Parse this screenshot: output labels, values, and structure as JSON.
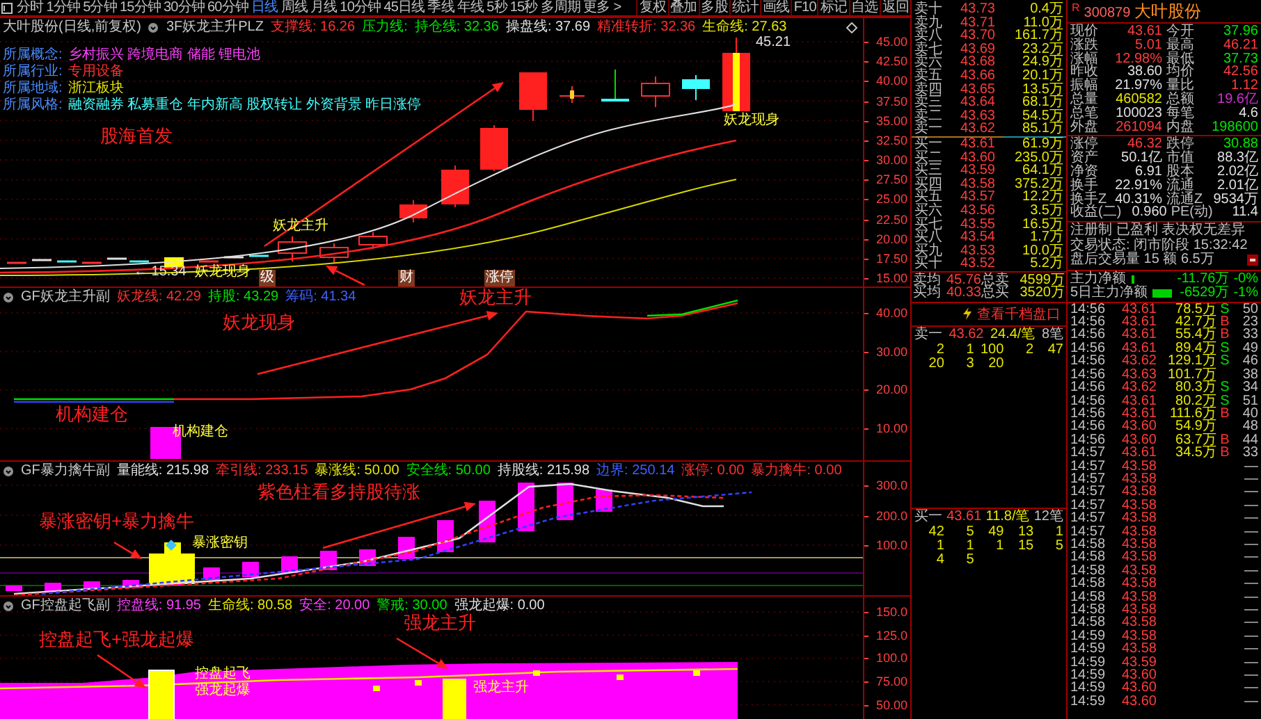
{
  "toolbar": {
    "tabs": [
      {
        "label": "分时",
        "selected": false
      },
      {
        "label": "1分钟",
        "selected": false
      },
      {
        "label": "5分钟",
        "selected": false
      },
      {
        "label": "15分钟",
        "selected": false
      },
      {
        "label": "30分钟",
        "selected": false
      },
      {
        "label": "60分钟",
        "selected": false
      },
      {
        "label": "日线",
        "selected": true
      },
      {
        "label": "周线",
        "selected": false
      },
      {
        "label": "月线",
        "selected": false
      },
      {
        "label": "10分钟",
        "selected": false
      },
      {
        "label": "45日线",
        "selected": false
      },
      {
        "label": "季线",
        "selected": false
      },
      {
        "label": "年线",
        "selected": false
      },
      {
        "label": "5秒",
        "selected": false
      },
      {
        "label": "15秒",
        "selected": false
      },
      {
        "label": "多周期",
        "selected": false
      },
      {
        "label": "更多 >",
        "selected": false
      }
    ],
    "buttons": [
      "复权",
      "叠加",
      "多股",
      "统计",
      "画线",
      "F10",
      "标记",
      "自选",
      "返回"
    ]
  },
  "panels": [
    {
      "kind": "candles",
      "legend": [
        {
          "text": "大叶股份(日线,前复权)",
          "kind": "value",
          "color": "#c8c8c8"
        },
        {
          "text": "3F妖龙主升PLZ",
          "kind": "name",
          "color": "#c8c8c8"
        },
        {
          "text": "支撑线: 16.26",
          "kind": "value",
          "color": "#ff3030"
        },
        {
          "text": "压力线:",
          "kind": "value",
          "color": "#00e000"
        },
        {
          "text": "持仓线: 32.36",
          "kind": "value",
          "color": "#00e000"
        },
        {
          "text": "操盘线: 37.69",
          "kind": "value",
          "color": "#e0e0e0"
        },
        {
          "text": "精准转折: 32.36",
          "kind": "value",
          "color": "#ff3030"
        },
        {
          "text": "生命线: 27.63",
          "kind": "value",
          "color": "#e6e600"
        }
      ],
      "info": [
        {
          "label": "所属概念:",
          "value": "乡村振兴 跨境电商 储能 锂电池",
          "color": "#ff40ff"
        },
        {
          "label": "所属行业:",
          "value": "专用设备",
          "color": "#ff3030"
        },
        {
          "label": "所属地域:",
          "value": "浙江板块",
          "color": "#e6e600"
        },
        {
          "label": "所属风格:",
          "value": "融资融券 私募重仓 年内新高 股权转让 外资背景 昨日涨停",
          "color": "#40ffff"
        }
      ],
      "annotations": [
        {
          "text": "股海首发",
          "kind": "big"
        },
        {
          "text": "45.21",
          "kind": "price"
        },
        {
          "text": "妖龙现身",
          "kind": "tag"
        },
        {
          "text": "← 15.34",
          "kind": "price"
        },
        {
          "text": "妖龙现身",
          "kind": "tag"
        },
        {
          "text": "妖龙主升",
          "kind": "tag"
        },
        {
          "text": "级",
          "kind": "box"
        },
        {
          "text": "财",
          "kind": "box"
        },
        {
          "text": "涨停",
          "kind": "box"
        }
      ],
      "axis": [
        "45.00",
        "42.50",
        "40.00",
        "37.50",
        "35.00",
        "32.50",
        "30.00",
        "27.50",
        "25.00",
        "22.50",
        "20.00",
        "17.50",
        "15.00"
      ]
    },
    {
      "kind": "line",
      "legend": [
        {
          "text": "GF妖龙主升副",
          "kind": "name",
          "color": "#c8c8c8"
        },
        {
          "text": "妖龙线: 42.29",
          "kind": "value",
          "color": "#ff3030"
        },
        {
          "text": "持股: 43.29",
          "kind": "value",
          "color": "#00e000"
        },
        {
          "text": "筹码: 41.34",
          "kind": "value",
          "color": "#4060ff"
        }
      ],
      "annotations": [
        {
          "text": "妖龙主升",
          "kind": "big"
        },
        {
          "text": "妖龙现身",
          "kind": "big"
        },
        {
          "text": "机构建仓",
          "kind": "big"
        },
        {
          "text": "机构建仓",
          "kind": "tag"
        }
      ],
      "axis": [
        "40.00",
        "30.00",
        "20.00",
        "10.00"
      ]
    },
    {
      "kind": "histogram",
      "legend": [
        {
          "text": "GF暴力擒牛副",
          "kind": "name",
          "color": "#c8c8c8"
        },
        {
          "text": "量能线: 215.98",
          "kind": "value",
          "color": "#e0e0e0"
        },
        {
          "text": "牵引线: 233.15",
          "kind": "value",
          "color": "#ff3030"
        },
        {
          "text": "暴涨线: 50.00",
          "kind": "value",
          "color": "#e6e600"
        },
        {
          "text": "安全线: 50.00",
          "kind": "value",
          "color": "#00e000"
        },
        {
          "text": "持股线: 215.98",
          "kind": "value",
          "color": "#e0e0e0"
        },
        {
          "text": "边界: 250.14",
          "kind": "value",
          "color": "#4060ff"
        },
        {
          "text": "涨停: 0.00",
          "kind": "value",
          "color": "#ff3030"
        },
        {
          "text": "暴力擒牛: 0.00",
          "kind": "value",
          "color": "#ff3030"
        }
      ],
      "annotations": [
        {
          "text": "暴涨密钥+暴力擒牛",
          "kind": "big"
        },
        {
          "text": "紫色柱看多持股待涨",
          "kind": "big"
        },
        {
          "text": "暴涨密钥",
          "kind": "tag"
        }
      ],
      "axis": [
        "300.0",
        "200.0",
        "100.0"
      ]
    },
    {
      "kind": "area",
      "legend": [
        {
          "text": "GF控盘起飞副",
          "kind": "name",
          "color": "#c8c8c8"
        },
        {
          "text": "控盘线: 91.95",
          "kind": "value",
          "color": "#ff40ff"
        },
        {
          "text": "生命线: 80.58",
          "kind": "value",
          "color": "#e6e600"
        },
        {
          "text": "安全: 20.00",
          "kind": "value",
          "color": "#ff40ff"
        },
        {
          "text": "警戒: 30.00",
          "kind": "value",
          "color": "#00e000"
        },
        {
          "text": "强龙起爆: 0.00",
          "kind": "value",
          "color": "#e0e0e0"
        }
      ],
      "annotations": [
        {
          "text": "控盘起飞+强龙起爆",
          "kind": "big"
        },
        {
          "text": "强龙主升",
          "kind": "big"
        },
        {
          "text": "控盘起飞",
          "kind": "tag"
        },
        {
          "text": "强龙起爆",
          "kind": "tag"
        },
        {
          "text": "强龙主升",
          "kind": "tag"
        }
      ],
      "axis": [
        "150.0",
        "125.0",
        "100.0",
        "75.00",
        "50.00"
      ]
    }
  ],
  "order_book": {
    "asks": [
      {
        "label": "卖十",
        "price": "43.73",
        "volume": "0.4万"
      },
      {
        "label": "卖九",
        "price": "43.71",
        "volume": "11.0万"
      },
      {
        "label": "卖八",
        "price": "43.70",
        "volume": "161.7万"
      },
      {
        "label": "卖七",
        "price": "43.69",
        "volume": "23.2万"
      },
      {
        "label": "卖六",
        "price": "43.68",
        "volume": "24.9万"
      },
      {
        "label": "卖五",
        "price": "43.66",
        "volume": "20.1万"
      },
      {
        "label": "卖四",
        "price": "43.65",
        "volume": "13.5万"
      },
      {
        "label": "卖三",
        "price": "43.64",
        "volume": "68.1万"
      },
      {
        "label": "卖二",
        "price": "43.63",
        "volume": "54.5万"
      },
      {
        "label": "卖一",
        "price": "43.62",
        "volume": "85.1万"
      }
    ],
    "bids": [
      {
        "label": "买一",
        "price": "43.61",
        "volume": "61.9万"
      },
      {
        "label": "买二",
        "price": "43.60",
        "volume": "235.0万"
      },
      {
        "label": "买三",
        "price": "43.59",
        "volume": "64.1万"
      },
      {
        "label": "买四",
        "price": "43.58",
        "volume": "375.2万"
      },
      {
        "label": "买五",
        "price": "43.57",
        "volume": "12.2万"
      },
      {
        "label": "买六",
        "price": "43.56",
        "volume": "3.5万"
      },
      {
        "label": "买七",
        "price": "43.55",
        "volume": "16.5万"
      },
      {
        "label": "买八",
        "price": "43.54",
        "volume": "1.7万"
      },
      {
        "label": "买九",
        "price": "43.53",
        "volume": "10.0万"
      },
      {
        "label": "买十",
        "price": "43.52",
        "volume": "5.2万"
      }
    ],
    "summary": [
      {
        "label": "卖均",
        "price": "45.76",
        "label2": "总卖",
        "value": "4599万"
      },
      {
        "label": "买均",
        "price": "40.33",
        "label2": "总买",
        "value": "3520万"
      }
    ],
    "depth_link": "查看千档盘口",
    "queues": [
      {
        "label": "卖一",
        "price": "43.62",
        "avg": "24.4/笔",
        "count": "8笔",
        "rows": [
          [
            "2",
            "1",
            "100",
            "2",
            "47"
          ],
          [
            "20",
            "3",
            "20"
          ]
        ]
      },
      {
        "label": "买一",
        "price": "43.61",
        "avg": "11.8/笔",
        "count": "12笔",
        "rows": [
          [
            "42",
            "5",
            "49",
            "13",
            "1"
          ],
          [
            "1",
            "1",
            "1",
            "15",
            "5"
          ],
          [
            "4",
            "5"
          ]
        ]
      }
    ]
  },
  "quote": {
    "badge": "R",
    "code": "300879",
    "name": "大叶股份",
    "stats": [
      [
        {
          "label": "现价",
          "value": "43.61",
          "color": "#ff3c3c"
        },
        {
          "label": "今开",
          "value": "37.96",
          "color": "#00e600"
        }
      ],
      [
        {
          "label": "涨跌",
          "value": "5.01",
          "color": "#ff3c3c"
        },
        {
          "label": "最高",
          "value": "46.21",
          "color": "#ff3c3c"
        }
      ],
      [
        {
          "label": "涨幅",
          "value": "12.98%",
          "color": "#ff3c3c"
        },
        {
          "label": "最低",
          "value": "37.73",
          "color": "#00e600"
        }
      ],
      [
        {
          "label": "昨收",
          "value": "38.60",
          "color": "#e0e0e0"
        },
        {
          "label": "均价",
          "value": "42.56",
          "color": "#ff3c3c"
        }
      ],
      [
        {
          "label": "振幅",
          "value": "21.97%",
          "color": "#e0e0e0"
        },
        {
          "label": "量比",
          "value": "1.12",
          "color": "#ff3c3c"
        }
      ],
      [
        {
          "label": "总量",
          "value": "460582",
          "color": "#e6e600"
        },
        {
          "label": "总额",
          "value": "19.6亿",
          "color": "#d030d0"
        }
      ],
      [
        {
          "label": "总笔",
          "value": "100023",
          "color": "#e0e0e0"
        },
        {
          "label": "每笔",
          "value": "4.6",
          "color": "#e0e0e0"
        }
      ],
      [
        {
          "label": "外盘",
          "value": "261094",
          "color": "#ff3c3c"
        },
        {
          "label": "内盘",
          "value": "198600",
          "color": "#00e600"
        }
      ]
    ],
    "fundamentals": [
      [
        {
          "label": "涨停",
          "value": "46.32",
          "color": "#ff3c3c"
        },
        {
          "label": "跌停",
          "value": "30.88",
          "color": "#00e600"
        }
      ],
      [
        {
          "label": "资产",
          "value": "50.1亿",
          "color": "#e0e0e0"
        },
        {
          "label": "市值",
          "value": "88.3亿",
          "color": "#e0e0e0"
        }
      ],
      [
        {
          "label": "净资",
          "value": "6.91",
          "color": "#e0e0e0"
        },
        {
          "label": "股本",
          "value": "2.02亿",
          "color": "#e0e0e0"
        }
      ],
      [
        {
          "label": "换手",
          "value": "22.91%",
          "color": "#e0e0e0"
        },
        {
          "label": "流通",
          "value": "2.01亿",
          "color": "#e0e0e0"
        }
      ],
      [
        {
          "label": "换手Z",
          "value": "40.31%",
          "color": "#e0e0e0"
        },
        {
          "label": "流通Z",
          "value": "9534万",
          "color": "#e0e0e0"
        }
      ],
      [
        {
          "label": "收益(二)",
          "value": "0.960",
          "color": "#e0e0e0"
        },
        {
          "label": "PE(动)",
          "value": "11.4",
          "color": "#e0e0e0"
        }
      ]
    ],
    "notes": [
      "注册制 已盈利 表决权无差异",
      "交易状态: 闭市阶段 15:32:42",
      "盘后交易量 15 额 6.5万"
    ],
    "fund_flow": [
      {
        "label": "主力净额",
        "value": "-11.76万",
        "pct": "-0%"
      },
      {
        "label": "5日主力净额",
        "value": "-6529万",
        "pct": "-1%"
      }
    ]
  },
  "ticks": [
    {
      "time": "14:56",
      "price": "43.61",
      "volume": "78.5万",
      "side": "S",
      "color": "#00e000",
      "count": "50"
    },
    {
      "time": "14:56",
      "price": "43.61",
      "volume": "42.7万",
      "side": "B",
      "color": "#ff3030",
      "count": "23"
    },
    {
      "time": "14:56",
      "price": "43.61",
      "volume": "55.4万",
      "side": "B",
      "color": "#ff3030",
      "count": "33"
    },
    {
      "time": "14:56",
      "price": "43.61",
      "volume": "89.4万",
      "side": "S",
      "color": "#00e000",
      "count": "49"
    },
    {
      "time": "14:56",
      "price": "43.62",
      "volume": "129.1万",
      "side": "S",
      "color": "#00e000",
      "count": "46"
    },
    {
      "time": "14:56",
      "price": "43.63",
      "volume": "101.7万",
      "count": "38"
    },
    {
      "time": "14:56",
      "price": "43.62",
      "volume": "80.3万",
      "side": "S",
      "color": "#00e000",
      "count": "34"
    },
    {
      "time": "14:56",
      "price": "43.61",
      "volume": "80.2万",
      "side": "S",
      "color": "#00e000",
      "count": "51"
    },
    {
      "time": "14:56",
      "price": "43.61",
      "volume": "111.6万",
      "side": "B",
      "color": "#ff3030",
      "count": "40"
    },
    {
      "time": "14:56",
      "price": "43.60",
      "volume": "54.9万",
      "count": "48"
    },
    {
      "time": "14:56",
      "price": "43.60",
      "volume": "63.7万",
      "side": "B",
      "color": "#ff3030",
      "count": "44"
    },
    {
      "time": "14:57",
      "price": "43.61",
      "volume": "34.5万",
      "side": "B",
      "color": "#ff3030",
      "count": "33"
    },
    {
      "time": "14:57",
      "price": "43.58",
      "count": "—"
    },
    {
      "time": "14:57",
      "price": "43.58",
      "count": "—"
    },
    {
      "time": "14:57",
      "price": "43.58",
      "count": "—"
    },
    {
      "time": "14:57",
      "price": "43.58",
      "count": "—"
    },
    {
      "time": "14:57",
      "price": "43.58",
      "count": "—"
    },
    {
      "time": "14:57",
      "price": "43.58",
      "count": "—"
    },
    {
      "time": "14:58",
      "price": "43.58",
      "count": "—"
    },
    {
      "time": "14:58",
      "price": "43.58",
      "count": "—"
    },
    {
      "time": "14:58",
      "price": "43.58",
      "count": "—"
    },
    {
      "time": "14:58",
      "price": "43.58",
      "count": "—"
    },
    {
      "time": "14:58",
      "price": "43.58",
      "count": "—"
    },
    {
      "time": "14:58",
      "price": "43.58",
      "count": "—"
    },
    {
      "time": "14:58",
      "price": "43.58",
      "count": "—"
    },
    {
      "time": "14:59",
      "price": "43.58",
      "count": "—"
    },
    {
      "time": "14:59",
      "price": "43.58",
      "count": "—"
    },
    {
      "time": "14:59",
      "price": "43.59",
      "count": "—"
    },
    {
      "time": "14:59",
      "price": "43.60",
      "count": "—"
    },
    {
      "time": "14:59",
      "price": "43.60",
      "count": "—"
    },
    {
      "time": "14:59",
      "price": "43.60",
      "count": "—"
    }
  ]
}
